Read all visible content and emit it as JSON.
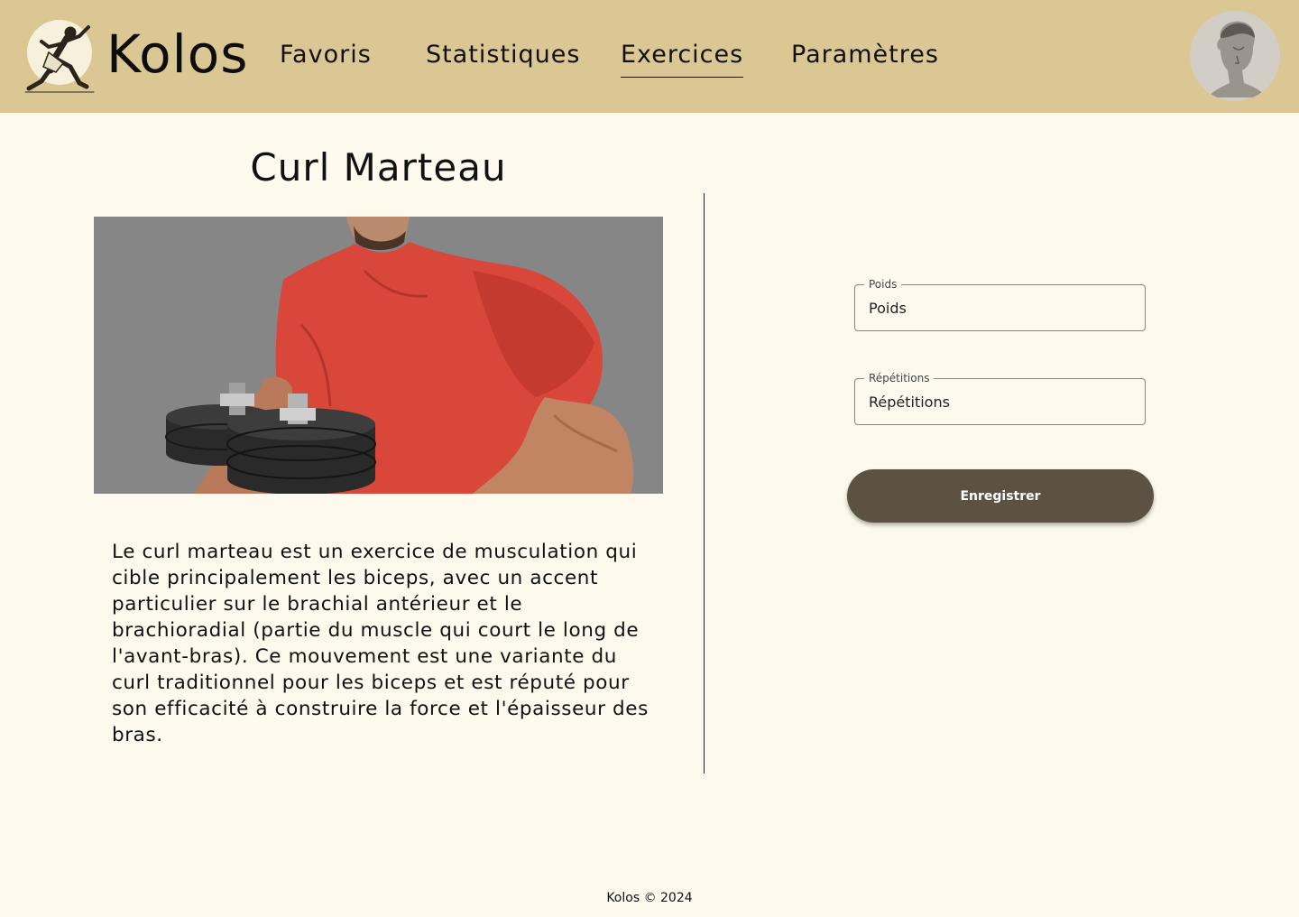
{
  "header": {
    "brand": "Kolos",
    "nav": [
      {
        "label": "Favoris",
        "active": false
      },
      {
        "label": "Statistiques",
        "active": false
      },
      {
        "label": "Exercices",
        "active": true
      },
      {
        "label": "Paramètres",
        "active": false
      }
    ],
    "logo_icon": "running-athlete-icon",
    "avatar_icon": "statue-bust-avatar"
  },
  "exercise": {
    "title": "Curl Marteau",
    "image_icon": "man-holding-dumbbell-photo",
    "description": "Le curl marteau est un exercice de musculation qui cible principalement les biceps, avec un accent particulier sur le brachial antérieur et le brachioradial (partie du muscle qui court le long de l'avant-bras). Ce mouvement est une variante du curl traditionnel pour les biceps et est réputé pour son efficacité à construire la force et l'épaisseur des bras."
  },
  "form": {
    "weight": {
      "label": "Poids",
      "placeholder": "Poids",
      "value": ""
    },
    "reps": {
      "label": "Répétitions",
      "placeholder": "Répétitions",
      "value": ""
    },
    "save_label": "Enregistrer"
  },
  "footer": {
    "text": "Kolos © 2024"
  },
  "colors": {
    "header_bg": "#dbc794",
    "page_bg": "#fdf9ec",
    "button_bg": "#5b5243",
    "shirt": "#d9473a"
  }
}
